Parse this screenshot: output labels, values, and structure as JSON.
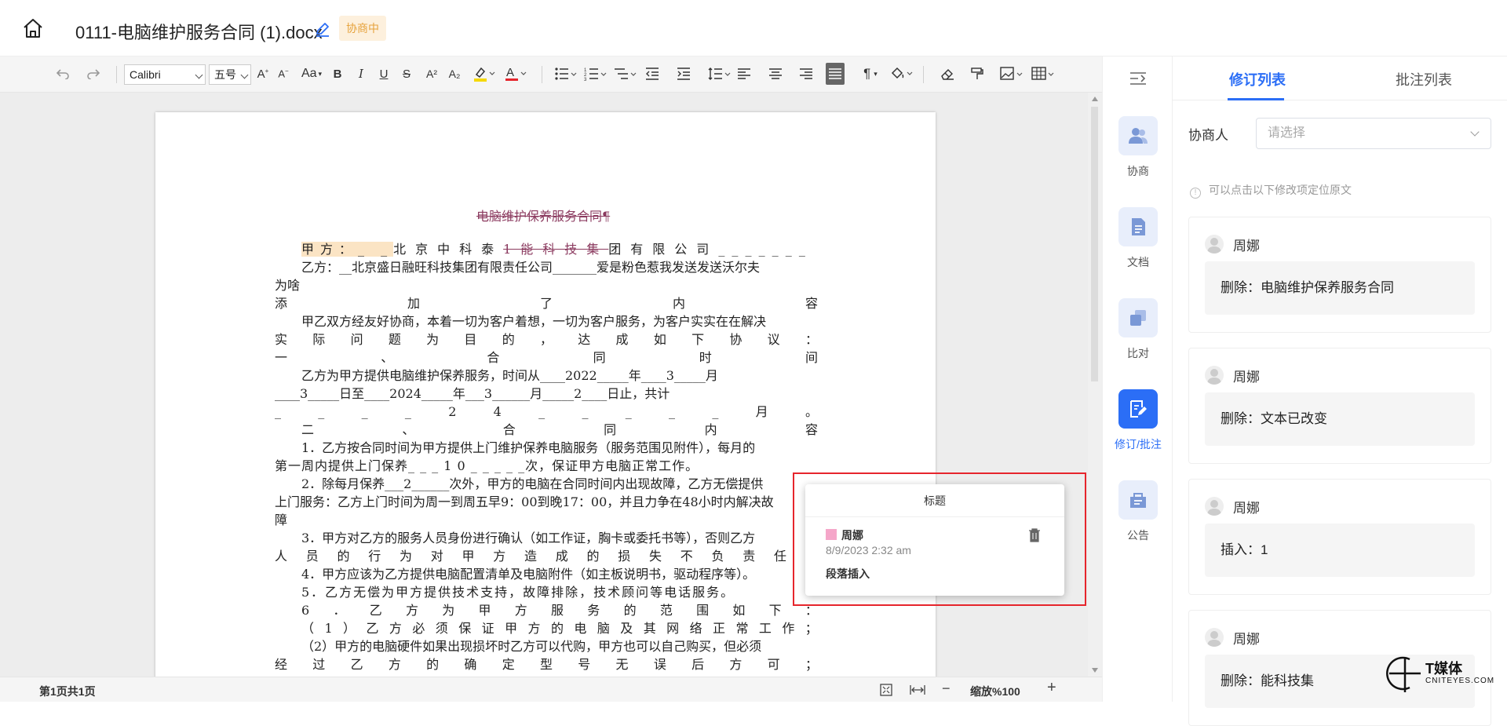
{
  "header": {
    "title": "0111-电脑维护服务合同 (1).docx",
    "status": "协商中",
    "accent_color": "#2b6ef6",
    "status_color": "#e6a23c"
  },
  "toolbar": {
    "font_family": "Calibri",
    "font_size": "五号",
    "case_label": "Aa",
    "bold_label": "B",
    "italic_label": "I",
    "underline_label": "U",
    "strike_label": "S",
    "sup_label": "A²",
    "sub_label": "A₂",
    "paragraph_mark": "¶"
  },
  "document": {
    "heading": "电脑维护保养服务合同¶",
    "party_a_prefix": "甲方：_ _",
    "party_a_mid": "北京中科泰",
    "party_a_deleted": "1能科技集",
    "party_a_suffix": "团有限公司",
    "party_a_blank": "_ _ _ _ _ _ _",
    "party_b": "乙方：__北京盛日融旺科技集团有限责任公司_______爱是粉色惹我发送发送沃尔夫",
    "line_wei": "为啥",
    "line_add": [
      "添",
      "加",
      "了",
      "内",
      "容"
    ],
    "para_intro_1": "甲乙双方经友好协商，本着一切为客户着想，一切为客户服务，为客户实实在在解决",
    "para_intro_2": [
      "实",
      "际",
      "问",
      "题",
      "为",
      "目",
      "的",
      "，",
      "达",
      "成",
      "如",
      "下",
      "协",
      "议",
      "："
    ],
    "section_one": [
      "一",
      "、",
      "合",
      "同",
      "时",
      "间"
    ],
    "period_1": "乙方为甲方提供电脑维护保养服务，时间从____2022_____年____3_____月",
    "period_2": "____3_____日至____2024_____年___3______月_____2____日止，共计",
    "period_3": [
      "_",
      "_",
      "_",
      "_",
      "2",
      "4",
      "_",
      "_",
      "_",
      "_",
      "_",
      "月",
      "。"
    ],
    "section_two": [
      "二",
      "、",
      "合",
      "同",
      "内",
      "容"
    ],
    "item_1a": "1．乙方按合同时间为甲方提供上门维护保养电脑服务（服务范围见附件），每月的",
    "item_1b": "第一周内提供上门保养_ _ _ 1 0 _ _ _ _ _次，保证甲方电脑正常工作。",
    "item_2a": "2．除每月保养___2______次外，甲方的电脑在合同时间内出现故障，乙方无偿提供",
    "item_2b": "上门服务：乙方上门时间为周一到周五早9：00到晚17：00，并且力争在48小时内解决故",
    "item_2c": "障",
    "item_3a": "3．甲方对乙方的服务人员身份进行确认（如工作证，胸卡或委托书等），否则乙方",
    "item_3b": [
      "人",
      "员",
      "的",
      "行",
      "为",
      "对",
      "甲",
      "方",
      "造",
      "成",
      "的",
      "损",
      "失",
      "不",
      "负",
      "责",
      "任",
      "。"
    ],
    "item_4": "4．甲方应该为乙方提供电脑配置清单及电脑附件（如主板说明书，驱动程序等）。",
    "item_5": "5．乙方无偿为甲方提供技术支持，故障排除，技术顾问等电话服务。",
    "item_6": [
      "6",
      "．",
      "乙",
      "方",
      "为",
      "甲",
      "方",
      "服",
      "务",
      "的",
      "范",
      "围",
      "如",
      "下",
      "："
    ],
    "item_6_1": [
      "（",
      "1",
      "）",
      "乙",
      "方",
      "必",
      "须",
      "保",
      "证",
      "甲",
      "方",
      "的",
      "电",
      "脑",
      "及",
      "其",
      "网",
      "络",
      "正",
      "常",
      "工",
      "作",
      "；"
    ],
    "item_6_2a": "（2）甲方的电脑硬件如果出现损坏时乙方可以代购，甲方也可以自己购买，但必须",
    "item_6_2b": [
      "经",
      "过",
      "乙",
      "方",
      "的",
      "确",
      "定",
      "型",
      "号",
      "无",
      "误",
      "后",
      "方",
      "可",
      "；"
    ]
  },
  "popup": {
    "header": "标题",
    "author": "周娜",
    "datetime": "8/9/2023 2:32 am",
    "action": "段落插入",
    "swatch_color": "#f5a6c9"
  },
  "statusbar": {
    "page": "第1页共1页",
    "zoom": "缩放%100",
    "minus": "−",
    "plus": "+"
  },
  "rail": {
    "items": [
      {
        "label": "协商",
        "icon": "users-icon"
      },
      {
        "label": "文档",
        "icon": "document-icon"
      },
      {
        "label": "比对",
        "icon": "compare-icon"
      },
      {
        "label": "修订/批注",
        "icon": "revision-icon",
        "active": true
      },
      {
        "label": "公告",
        "icon": "announcement-icon"
      }
    ]
  },
  "right_panel": {
    "tabs": [
      "修订列表",
      "批注列表"
    ],
    "negotiator_label": "协商人",
    "select_placeholder": "请选择",
    "hint": "可以点击以下修改项定位原文",
    "cards": [
      {
        "author": "周娜",
        "content": "删除：电脑维护保养服务合同"
      },
      {
        "author": "周娜",
        "content": "删除：文本已改变"
      },
      {
        "author": "周娜",
        "content": "插入：1"
      },
      {
        "author": "周娜",
        "content": "删除：能科技集"
      }
    ]
  },
  "watermark": {
    "brand": "T媒体",
    "url": "CNITEYES.COM"
  }
}
